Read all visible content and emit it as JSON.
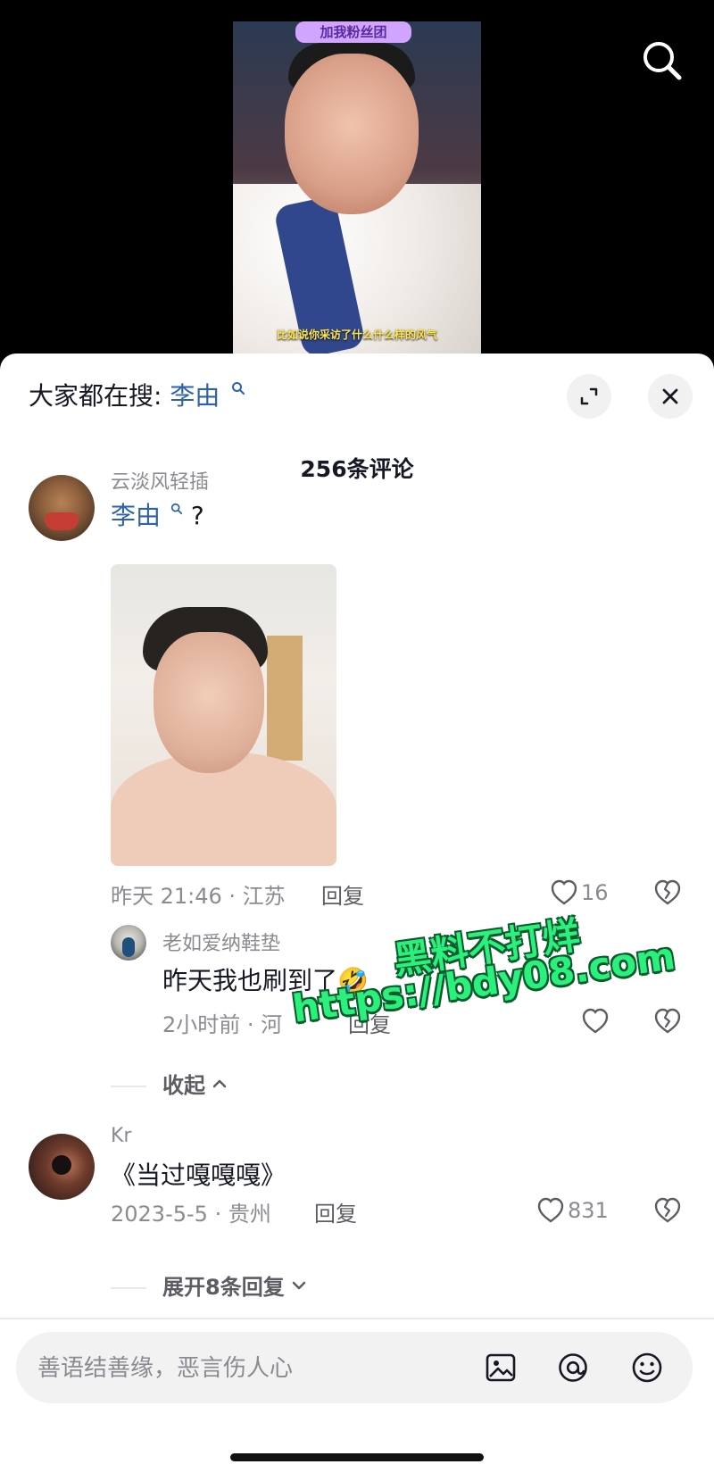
{
  "video": {
    "sign_text": "加我粉丝团",
    "subtitle": "比如说你采访了什么什么样的风气"
  },
  "header": {
    "trending_prefix": "大家都在搜:",
    "trending_keyword": "李由",
    "comment_count": "256条评论"
  },
  "comments": [
    {
      "username": "云淡风轻插",
      "text": "李由",
      "suffix": "?",
      "meta": "昨天 21:46 · 江苏",
      "reply_label": "回复",
      "likes": "16"
    },
    {
      "username": "Kr",
      "text": "《当过嘎嘎嘎》",
      "meta": "2023-5-5 · 贵州",
      "reply_label": "回复",
      "likes": "831"
    }
  ],
  "replies": [
    {
      "username": "老如爱纳鞋垫",
      "text": "昨天我也刷到了🤣",
      "meta": "2小时前 · 河",
      "reply_label": "回复"
    }
  ],
  "threads": {
    "collapse_label": "收起",
    "expand_label": "展开8条回复"
  },
  "watermark": {
    "line1": "黑料不打烊",
    "line2": "https://bdy08.com"
  },
  "composer": {
    "placeholder": "善语结善缘，恶言伤人心"
  },
  "icons": {
    "search": "search-icon",
    "expand": "expand-icon",
    "close": "close-icon",
    "like": "heart-outline-icon",
    "dislike": "broken-heart-icon",
    "image": "image-icon",
    "mention": "at-sign-icon",
    "emoji": "emoji-icon"
  }
}
